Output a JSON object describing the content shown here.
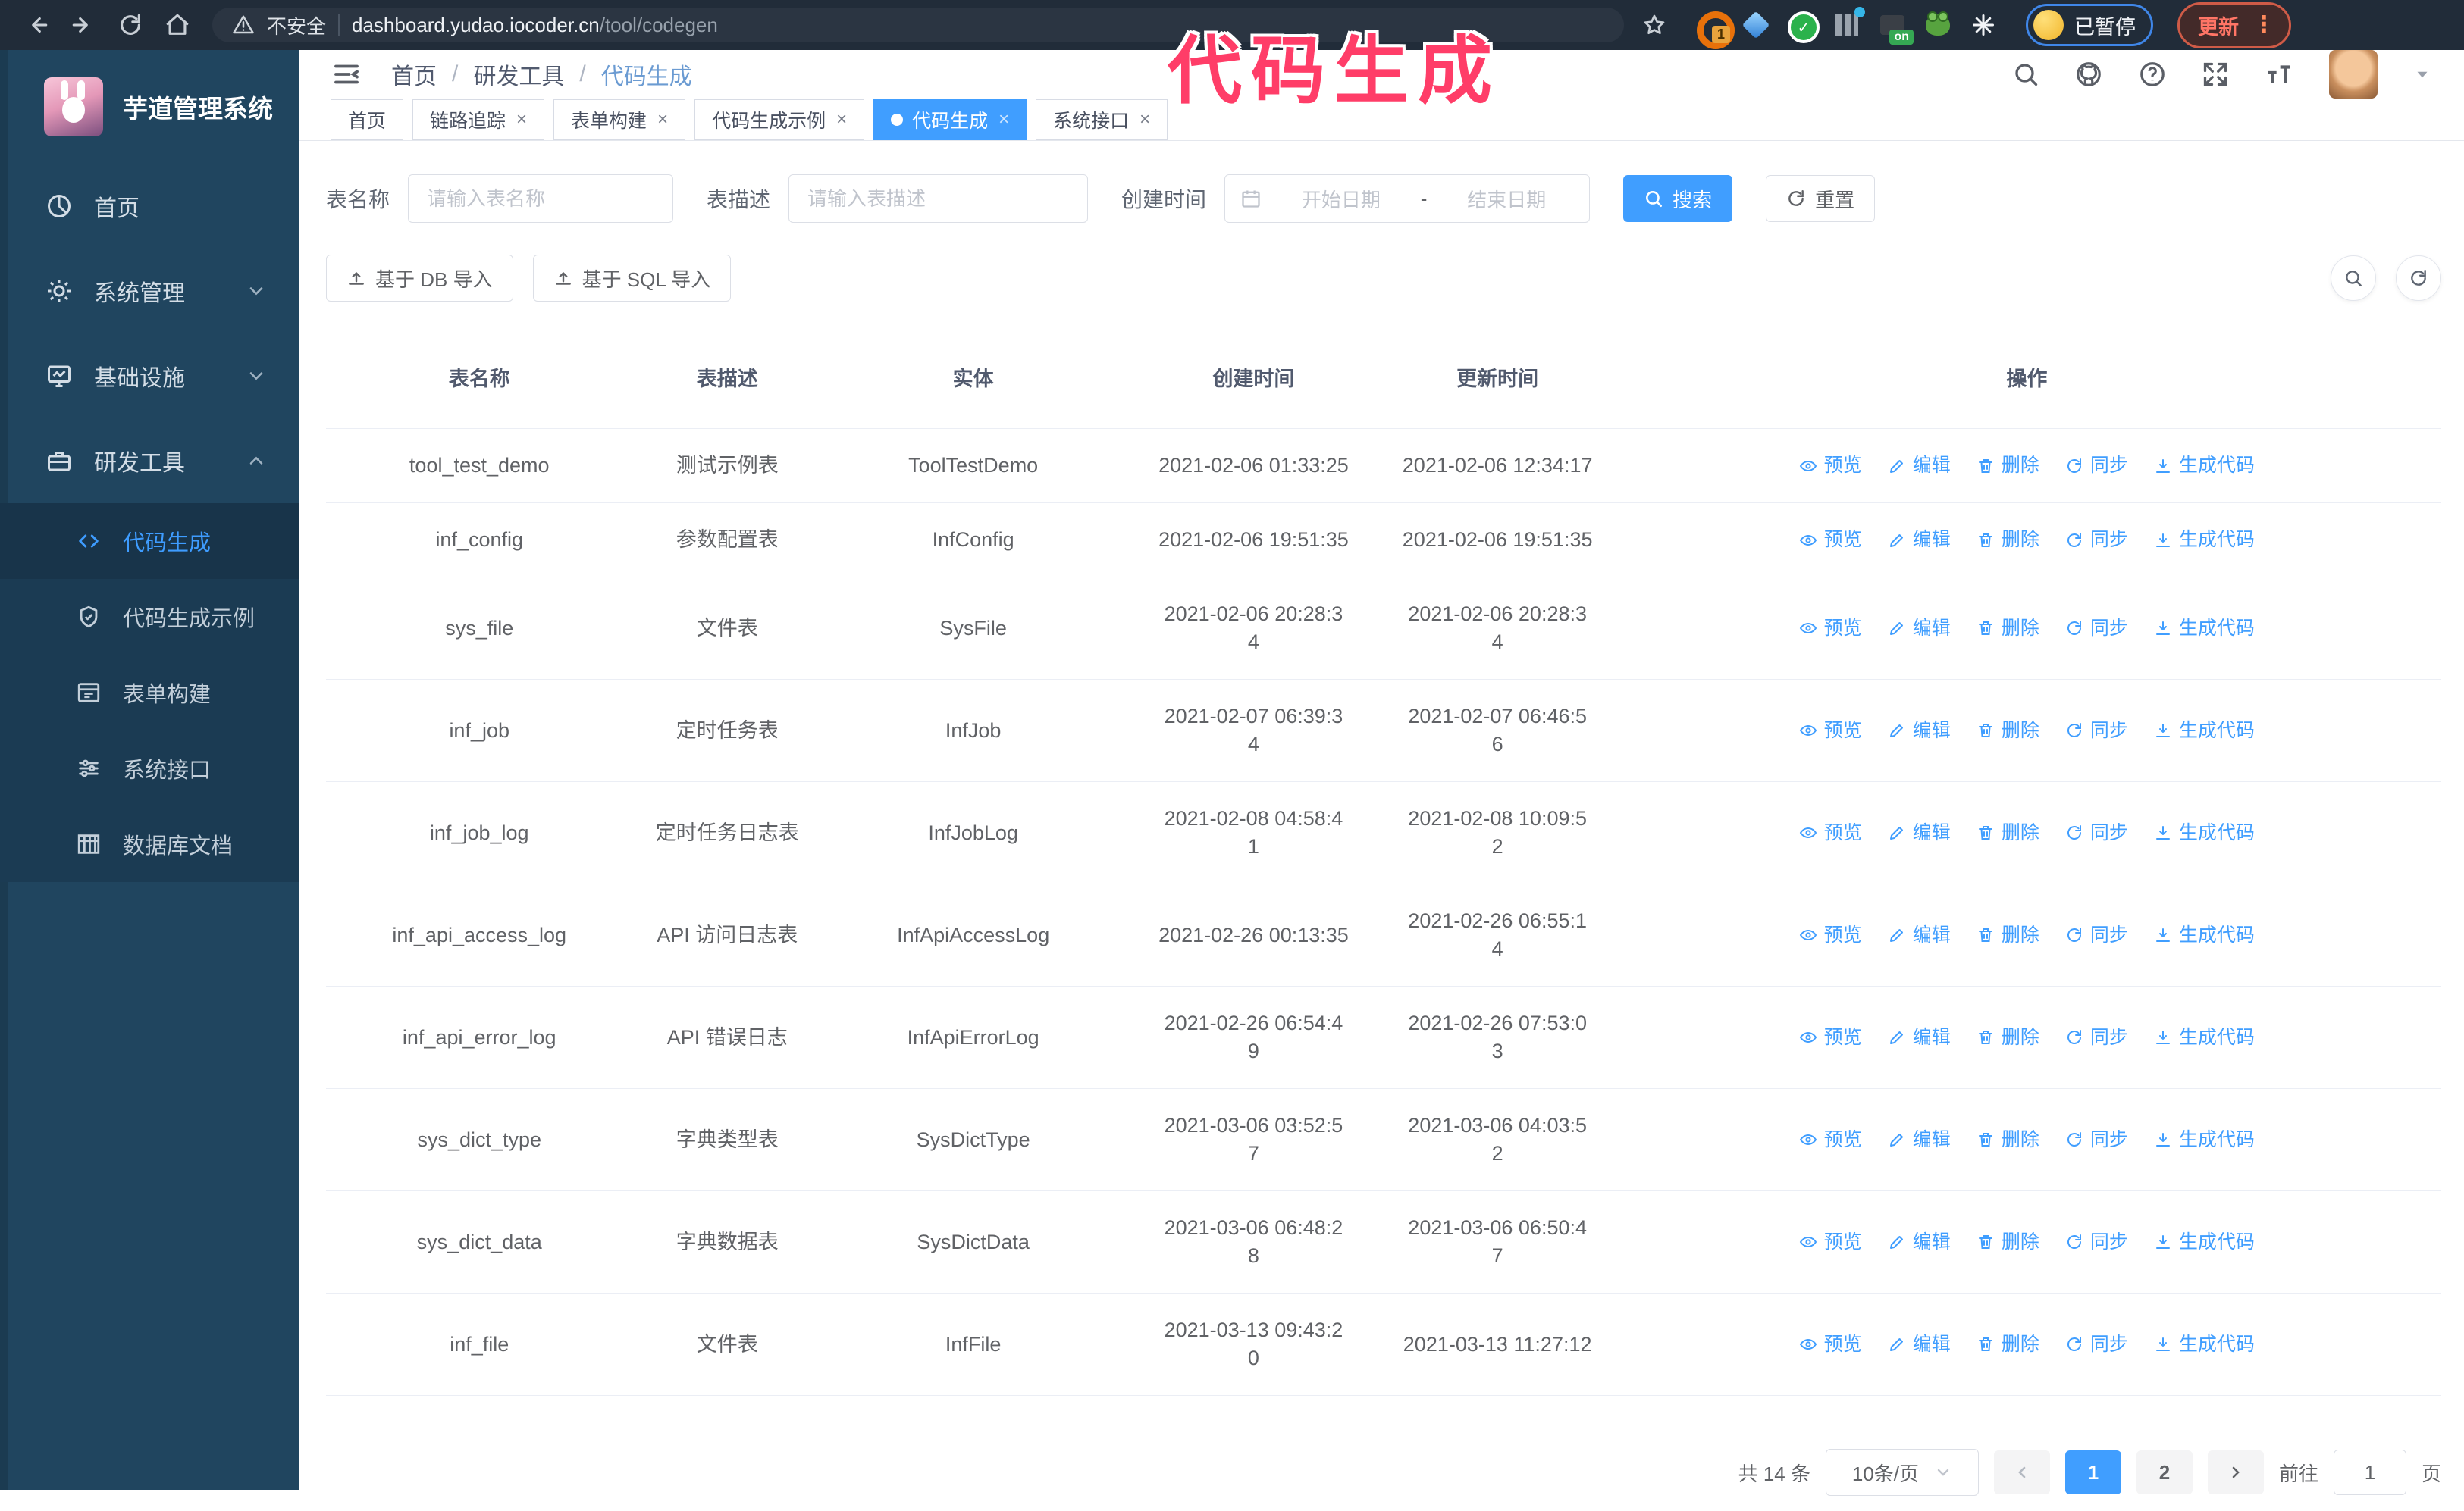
{
  "browser": {
    "security_warning": "不安全",
    "url_host": "dashboard.yudao.iocoder.cn",
    "url_path": "/tool/codegen",
    "ext_badge_count": "1",
    "ext_badge_on": "on",
    "paused_badge": "已暂停",
    "update_label": "更新",
    "update_dots": "⋮"
  },
  "annotation": {
    "text": "代码生成",
    "color": "#ff3d68"
  },
  "sidebar": {
    "app_title": "芋道管理系统",
    "items": [
      {
        "label": "首页",
        "icon": "dashboard-icon"
      },
      {
        "label": "系统管理",
        "icon": "gear-icon"
      },
      {
        "label": "基础设施",
        "icon": "monitor-icon"
      },
      {
        "label": "研发工具",
        "icon": "toolbox-icon"
      }
    ],
    "subitems": [
      {
        "label": "代码生成",
        "icon": "code-icon"
      },
      {
        "label": "代码生成示例",
        "icon": "shield-check-icon"
      },
      {
        "label": "表单构建",
        "icon": "form-icon"
      },
      {
        "label": "系统接口",
        "icon": "sliders-icon"
      },
      {
        "label": "数据库文档",
        "icon": "database-table-icon"
      }
    ]
  },
  "header": {
    "breadcrumb": [
      {
        "label": "首页"
      },
      {
        "label": "研发工具"
      },
      {
        "label": "代码生成"
      }
    ],
    "separator": "/"
  },
  "tabs": [
    {
      "label": "首页"
    },
    {
      "label": "链路追踪"
    },
    {
      "label": "表单构建"
    },
    {
      "label": "代码生成示例"
    },
    {
      "label": "代码生成"
    },
    {
      "label": "系统接口"
    }
  ],
  "filters": {
    "table_name_label": "表名称",
    "table_name_placeholder": "请输入表名称",
    "table_desc_label": "表描述",
    "table_desc_placeholder": "请输入表描述",
    "create_time_label": "创建时间",
    "date_start_placeholder": "开始日期",
    "date_separator": "-",
    "date_end_placeholder": "结束日期",
    "search_label": "搜索",
    "reset_label": "重置"
  },
  "import_toolbar": {
    "db_button": "基于 DB 导入",
    "sql_button": "基于 SQL 导入"
  },
  "table": {
    "columns": [
      "表名称",
      "表描述",
      "实体",
      "创建时间",
      "更新时间",
      "操作"
    ],
    "actions": [
      "预览",
      "编辑",
      "删除",
      "同步",
      "生成代码"
    ],
    "rows": [
      {
        "name": "tool_test_demo",
        "desc": "测试示例表",
        "entity": "ToolTestDemo",
        "created": "2021-02-06 01:33:25",
        "updated": "2021-02-06 12:34:17"
      },
      {
        "name": "inf_config",
        "desc": "参数配置表",
        "entity": "InfConfig",
        "created": "2021-02-06 19:51:35",
        "updated": "2021-02-06 19:51:35"
      },
      {
        "name": "sys_file",
        "desc": "文件表",
        "entity": "SysFile",
        "created": "2021-02-06 20:28:3\n4",
        "updated": "2021-02-06 20:28:3\n4"
      },
      {
        "name": "inf_job",
        "desc": "定时任务表",
        "entity": "InfJob",
        "created": "2021-02-07 06:39:3\n4",
        "updated": "2021-02-07 06:46:5\n6"
      },
      {
        "name": "inf_job_log",
        "desc": "定时任务日志表",
        "entity": "InfJobLog",
        "created": "2021-02-08 04:58:4\n1",
        "updated": "2021-02-08 10:09:5\n2"
      },
      {
        "name": "inf_api_access_log",
        "desc": "API 访问日志表",
        "entity": "InfApiAccessLog",
        "created": "2021-02-26 00:13:35",
        "updated": "2021-02-26 06:55:1\n4"
      },
      {
        "name": "inf_api_error_log",
        "desc": "API 错误日志",
        "entity": "InfApiErrorLog",
        "created": "2021-02-26 06:54:4\n9",
        "updated": "2021-02-26 07:53:0\n3"
      },
      {
        "name": "sys_dict_type",
        "desc": "字典类型表",
        "entity": "SysDictType",
        "created": "2021-03-06 03:52:5\n7",
        "updated": "2021-03-06 04:03:5\n2"
      },
      {
        "name": "sys_dict_data",
        "desc": "字典数据表",
        "entity": "SysDictData",
        "created": "2021-03-06 06:48:2\n8",
        "updated": "2021-03-06 06:50:4\n7"
      },
      {
        "name": "inf_file",
        "desc": "文件表",
        "entity": "InfFile",
        "created": "2021-03-13 09:43:2\n0",
        "updated": "2021-03-13 11:27:12"
      }
    ]
  },
  "pagination": {
    "total_text": "共 14 条",
    "page_size": "10条/页",
    "page_1": "1",
    "page_2": "2",
    "goto_label": "前往",
    "goto_value": "1",
    "goto_unit": "页"
  },
  "colors": {
    "accent": "#409eff",
    "sidebar_bg": "#20455f",
    "submenu_bg": "#1b3b53",
    "browser_toolbar_bg": "#212c39",
    "annotation_pink": "#ff3d68",
    "table_border": "#ebeef5"
  }
}
